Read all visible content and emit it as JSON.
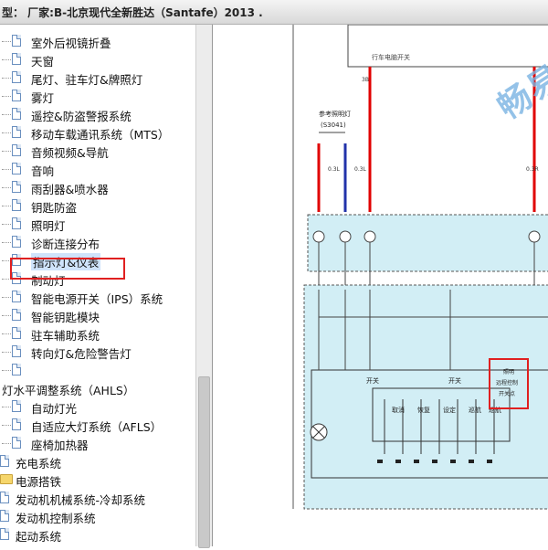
{
  "window": {
    "title": "型：  厂家:B-北京现代全新胜达（Santafe）2013   ."
  },
  "tree": {
    "items": [
      {
        "label": "室外后视镜折叠",
        "type": "doc"
      },
      {
        "label": "天窗",
        "type": "doc"
      },
      {
        "label": "尾灯、驻车灯&牌照灯",
        "type": "doc"
      },
      {
        "label": "雾灯",
        "type": "doc"
      },
      {
        "label": "遥控&防盗警报系统",
        "type": "doc"
      },
      {
        "label": "移动车载通讯系统（MTS）",
        "type": "doc"
      },
      {
        "label": "音频视频&导航",
        "type": "doc"
      },
      {
        "label": "音响",
        "type": "doc"
      },
      {
        "label": "雨刮器&喷水器",
        "type": "doc"
      },
      {
        "label": "钥匙防盗",
        "type": "doc"
      },
      {
        "label": "照明灯",
        "type": "doc"
      },
      {
        "label": "诊断连接分布",
        "type": "doc"
      },
      {
        "label": "指示灯&仪表",
        "type": "doc",
        "selected": true
      },
      {
        "label": "制动灯",
        "type": "doc"
      },
      {
        "label": "智能电源开关（IPS）系统",
        "type": "doc"
      },
      {
        "label": "智能钥匙模块",
        "type": "doc"
      },
      {
        "label": "驻车辅助系统",
        "type": "doc"
      },
      {
        "label": "转向灯&危险警告灯",
        "type": "doc"
      },
      {
        "label": "",
        "type": "doc"
      },
      {
        "label": "灯水平调整系统（AHLS）",
        "type": "text"
      },
      {
        "label": "自动灯光",
        "type": "doc"
      },
      {
        "label": "自适应大灯系统（AFLS）",
        "type": "doc"
      },
      {
        "label": "座椅加热器",
        "type": "doc"
      },
      {
        "label": "充电系统",
        "type": "doc"
      },
      {
        "label": "电源搭铁",
        "type": "folder"
      },
      {
        "label": "发动机机械系统-冷却系统",
        "type": "doc"
      },
      {
        "label": "发动机控制系统",
        "type": "doc"
      },
      {
        "label": "起动系统",
        "type": "doc"
      }
    ]
  },
  "diagram": {
    "watermark": "畅易汽车维修平",
    "label_top": "行车电脑开关",
    "label_ref": "参考照明灯",
    "label_ref_code": "(S3041)",
    "label_ctrl": "照明\n远程控制\n开关点",
    "wire_labels": [
      "3B",
      "0.3L",
      "0.3L",
      "0.3R"
    ],
    "switch_labels": [
      "开关",
      "开关",
      "取消",
      "恢复",
      "设定",
      "巡航",
      "巡航"
    ],
    "highlight_color": "#e02020"
  }
}
